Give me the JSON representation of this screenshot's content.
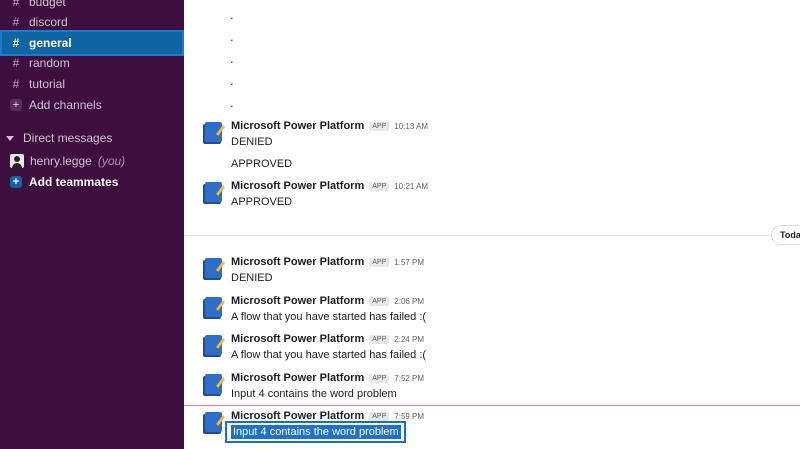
{
  "sidebar": {
    "channels": [
      {
        "label": "budget",
        "icon": "hash-icon"
      },
      {
        "label": "discord",
        "icon": "hash-icon"
      },
      {
        "label": "general",
        "icon": "hash-icon",
        "active": true
      },
      {
        "label": "random",
        "icon": "hash-icon"
      },
      {
        "label": "tutorial",
        "icon": "hash-icon"
      }
    ],
    "hash_symbol": "#",
    "add_channels_label": "Add channels",
    "plus_symbol": "+",
    "direct_messages_header": "Direct messages",
    "dm_user": {
      "name": "henry.legge",
      "you_label": "(you)"
    },
    "add_teammates_label": "Add teammates"
  },
  "main": {
    "dots": [
      ".",
      ".",
      ".",
      ".",
      "."
    ],
    "day_divider_label": "Toda",
    "messages": [
      {
        "sender": "Microsoft Power Platform",
        "badge": "APP",
        "time": "10:13 AM",
        "lines": [
          "DENIED",
          "APPROVED"
        ]
      },
      {
        "sender": "Microsoft Power Platform",
        "badge": "APP",
        "time": "10:21 AM",
        "lines": [
          "APPROVED"
        ]
      },
      {
        "sender": "Microsoft Power Platform",
        "badge": "APP",
        "time": "1:57 PM",
        "lines": [
          "DENIED"
        ]
      },
      {
        "sender": "Microsoft Power Platform",
        "badge": "APP",
        "time": "2:06 PM",
        "lines": [
          "A flow that you have started has failed :("
        ]
      },
      {
        "sender": "Microsoft Power Platform",
        "badge": "APP",
        "time": "2:24 PM",
        "lines": [
          "A flow that you have started has failed :("
        ]
      },
      {
        "sender": "Microsoft Power Platform",
        "badge": "APP",
        "time": "7:52 PM",
        "lines": [
          "Input 4 contains the word problem"
        ]
      },
      {
        "sender": "Microsoft Power Platform",
        "badge": "APP",
        "time": "7:59 PM",
        "lines": [
          "Input 4 contains the word problem"
        ]
      }
    ]
  },
  "colors": {
    "sidebar_bg": "#3f0e40",
    "active_channel": "#1164a3",
    "selection": "#1d6fd0"
  }
}
